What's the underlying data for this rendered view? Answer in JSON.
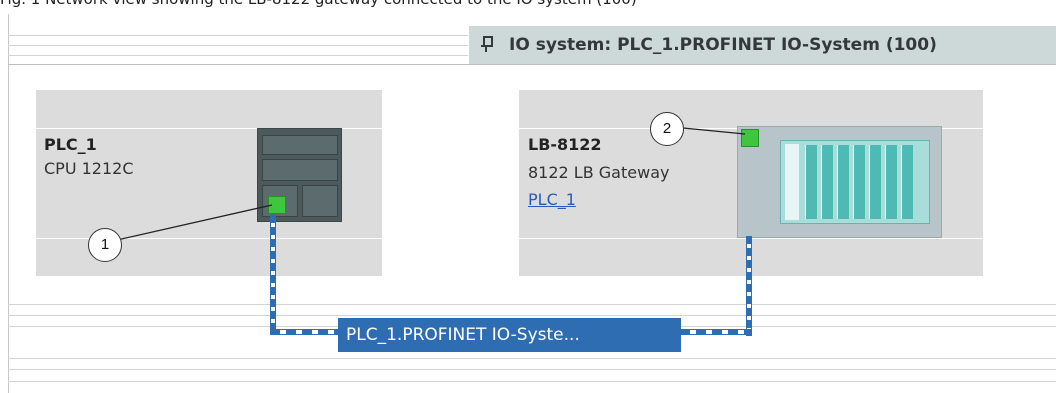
{
  "top_caption": "Fig. 1 Network view showing the LB-8122 gateway connected to the IO system (100)",
  "io_system": {
    "label": "IO system: PLC_1.PROFINET IO-System (100)",
    "icon": "pin-icon"
  },
  "devices": [
    {
      "name": "PLC_1",
      "type": "CPU 1212C",
      "link": ""
    },
    {
      "name": "LB-8122",
      "type": "8122 LB Gateway",
      "link": "PLC_1"
    }
  ],
  "network": {
    "label": "PLC_1.PROFINET IO-Syste..."
  },
  "callouts": [
    "1",
    "2"
  ],
  "colors": {
    "bus": "#2f6db3",
    "port": "#3ec63e",
    "io_tag_bg": "#cdd8d9",
    "device_bg": "#dcdcdc"
  }
}
